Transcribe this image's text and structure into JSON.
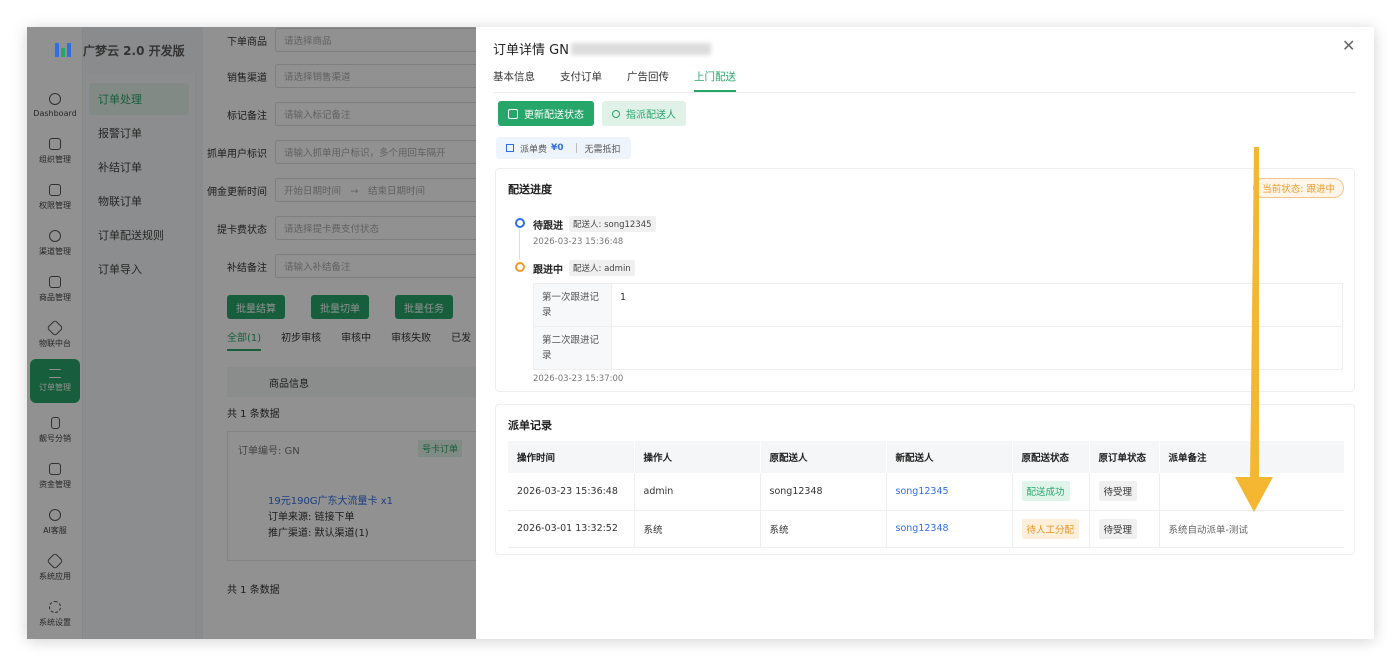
{
  "app": {
    "name": "广梦云 2.0 开发版"
  },
  "nav": [
    {
      "label": "Dashboard",
      "icon": "dashboard-icon"
    },
    {
      "label": "组织管理",
      "icon": "org-icon"
    },
    {
      "label": "权限管理",
      "icon": "permission-icon"
    },
    {
      "label": "渠道管理",
      "icon": "channel-icon"
    },
    {
      "label": "商品管理",
      "icon": "goods-icon"
    },
    {
      "label": "物联中台",
      "icon": "iot-icon"
    },
    {
      "label": "订单管理",
      "icon": "order-icon"
    },
    {
      "label": "靓号分销",
      "icon": "phone-icon"
    },
    {
      "label": "资金管理",
      "icon": "fund-icon"
    },
    {
      "label": "AI客服",
      "icon": "ai-icon"
    },
    {
      "label": "系统应用",
      "icon": "app-icon"
    },
    {
      "label": "系统设置",
      "icon": "settings-icon"
    }
  ],
  "submenu": [
    "订单处理",
    "报警订单",
    "补结订单",
    "物联订单",
    "订单配送规则",
    "订单导入"
  ],
  "filters": [
    {
      "label": "下单商品",
      "placeholder": "请选择商品"
    },
    {
      "label": "销售渠道",
      "placeholder": "请选择销售渠道"
    },
    {
      "label": "标记备注",
      "placeholder": "请输入标记备注"
    },
    {
      "label": "抓单用户标识",
      "placeholder": "请输入抓单用户标识，多个用回车隔开"
    },
    {
      "label": "佣金更新时间",
      "placeholder": "开始日期时间　→　结束日期时间"
    },
    {
      "label": "提卡费状态",
      "placeholder": "请选择提卡费支付状态"
    },
    {
      "label": "补结备注",
      "placeholder": "请输入补结备注"
    }
  ],
  "bg_buttons": [
    "批量结算",
    "批量切单",
    "批量任务"
  ],
  "bg_tabs": [
    "全部(1)",
    "初步审核",
    "审核中",
    "审核失败",
    "已发"
  ],
  "bg_table": {
    "header": "商品信息",
    "total": "共 1 条数据",
    "order_no_label": "订单编号: GN",
    "order_tag": "号卡订单",
    "product": "19元190G广东大流量卡 x1",
    "source": "订单来源: 链接下单",
    "channel": "推广渠道: 默认渠道(1)",
    "total_bottom": "共 1 条数据"
  },
  "drawer": {
    "title_prefix": "订单详情 GN",
    "tabs": [
      "基本信息",
      "支付订单",
      "广告回传",
      "上门配送"
    ],
    "btn_update": "更新配送状态",
    "btn_assign": "指派配送人",
    "fee_label": "派单费",
    "fee_amount": "¥0",
    "fee_note": "无需抵扣",
    "progress": {
      "title": "配送进度",
      "current_status": "当前状态: 跟进中",
      "steps": [
        {
          "status": "待跟进",
          "courier": "配送人: song12345",
          "time": "2026-03-23 15:36:48"
        },
        {
          "status": "跟进中",
          "courier": "配送人: admin",
          "time": "2026-03-23 15:37:00"
        }
      ],
      "records": [
        {
          "label": "第一次跟进记录",
          "value": "1"
        },
        {
          "label": "第二次跟进记录",
          "value": ""
        }
      ]
    },
    "dispatch": {
      "title": "派单记录",
      "columns": [
        "操作时间",
        "操作人",
        "原配送人",
        "新配送人",
        "原配送状态",
        "原订单状态",
        "派单备注"
      ],
      "rows": [
        [
          "2026-03-23 15:36:48",
          "admin",
          "song12348",
          "song12345",
          "配送成功",
          "待受理",
          ""
        ],
        [
          "2026-03-01 13:32:52",
          "系统",
          "系统",
          "song12348",
          "待人工分配",
          "待受理",
          "系统自动派单-测试"
        ]
      ]
    }
  },
  "colors": {
    "accent": "#27a66a",
    "link": "#2f6fe4",
    "warning": "#f09a2a",
    "arrow": "#f5b731"
  }
}
